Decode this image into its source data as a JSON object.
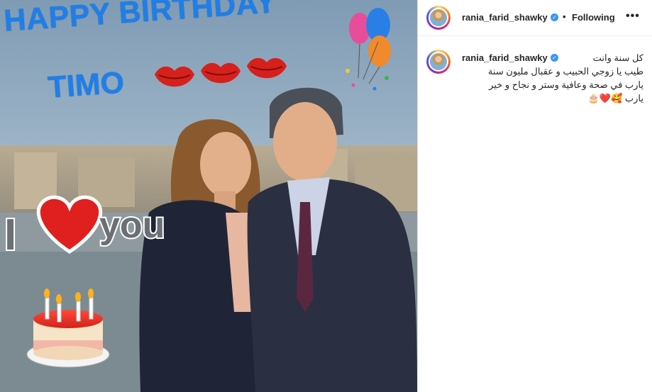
{
  "post": {
    "image": {
      "title_line1": "HAPPY BIRTHDAY",
      "title_line2": "TIMO",
      "love_text": "you"
    }
  },
  "header": {
    "username": "rania_farid_shawky",
    "separator": "•",
    "follow_status": "Following",
    "more_label": "•••"
  },
  "caption": {
    "username": "rania_farid_shawky",
    "lines": [
      "كل سنة وانت",
      "طيب يا زوجي الحبيب و عقبال مليون سنة",
      "يارب في صحة وعافية وستر و نجاح و خير",
      "يارب 🥰❤️🎂"
    ]
  },
  "colors": {
    "verified": "#3897f0",
    "birthday_text": "#1f7fe8",
    "heart": "#e0201e"
  }
}
